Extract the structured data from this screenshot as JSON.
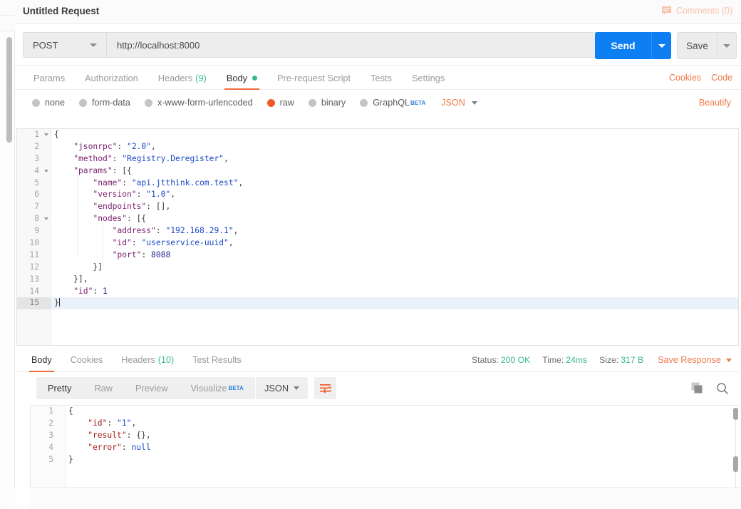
{
  "request": {
    "title": "Untitled Request",
    "comments_label": "Comments (0)",
    "method": "POST",
    "url": "http://localhost:8000",
    "send_label": "Send",
    "save_label": "Save",
    "tabs": [
      {
        "label": "Params",
        "active": false
      },
      {
        "label": "Authorization",
        "active": false
      },
      {
        "label": "Headers",
        "count": "(9)",
        "active": false
      },
      {
        "label": "Body",
        "active": true,
        "dot": true
      },
      {
        "label": "Pre-request Script",
        "active": false
      },
      {
        "label": "Tests",
        "active": false
      },
      {
        "label": "Settings",
        "active": false
      }
    ],
    "header_links": [
      "Cookies",
      "Code"
    ],
    "body_types": [
      {
        "label": "none",
        "selected": false
      },
      {
        "label": "form-data",
        "selected": false
      },
      {
        "label": "x-www-form-urlencoded",
        "selected": false
      },
      {
        "label": "raw",
        "selected": true
      },
      {
        "label": "binary",
        "selected": false
      },
      {
        "label": "GraphQL",
        "selected": false,
        "beta": "BETA"
      }
    ],
    "format_label": "JSON",
    "beautify_label": "Beautify",
    "editor_lines": [
      {
        "n": "1",
        "fold": true,
        "active": false,
        "tokens": [
          {
            "t": "{",
            "c": "jpun"
          }
        ]
      },
      {
        "n": "2",
        "fold": false,
        "active": false,
        "tokens": [
          {
            "t": "    \"jsonrpc\"",
            "c": "jkey"
          },
          {
            "t": ": ",
            "c": "jpun"
          },
          {
            "t": "\"2.0\"",
            "c": "jstr"
          },
          {
            "t": ",",
            "c": "jpun"
          }
        ]
      },
      {
        "n": "3",
        "fold": false,
        "active": false,
        "tokens": [
          {
            "t": "    \"method\"",
            "c": "jkey"
          },
          {
            "t": ": ",
            "c": "jpun"
          },
          {
            "t": "\"Registry.Deregister\"",
            "c": "jstr"
          },
          {
            "t": ",",
            "c": "jpun"
          }
        ]
      },
      {
        "n": "4",
        "fold": true,
        "active": false,
        "tokens": [
          {
            "t": "    \"params\"",
            "c": "jkey"
          },
          {
            "t": ": [{",
            "c": "jpun"
          }
        ]
      },
      {
        "n": "5",
        "fold": false,
        "active": false,
        "tokens": [
          {
            "t": "        \"name\"",
            "c": "jkey"
          },
          {
            "t": ": ",
            "c": "jpun"
          },
          {
            "t": "\"api.jtthink.com.test\"",
            "c": "jstr"
          },
          {
            "t": ",",
            "c": "jpun"
          }
        ]
      },
      {
        "n": "6",
        "fold": false,
        "active": false,
        "tokens": [
          {
            "t": "        \"version\"",
            "c": "jkey"
          },
          {
            "t": ": ",
            "c": "jpun"
          },
          {
            "t": "\"1.0\"",
            "c": "jstr"
          },
          {
            "t": ",",
            "c": "jpun"
          }
        ]
      },
      {
        "n": "7",
        "fold": false,
        "active": false,
        "tokens": [
          {
            "t": "        \"endpoints\"",
            "c": "jkey"
          },
          {
            "t": ": [],",
            "c": "jpun"
          }
        ]
      },
      {
        "n": "8",
        "fold": true,
        "active": false,
        "tokens": [
          {
            "t": "        \"nodes\"",
            "c": "jkey"
          },
          {
            "t": ": [{",
            "c": "jpun"
          }
        ]
      },
      {
        "n": "9",
        "fold": false,
        "active": false,
        "tokens": [
          {
            "t": "            \"address\"",
            "c": "jkey"
          },
          {
            "t": ": ",
            "c": "jpun"
          },
          {
            "t": "\"192.168.29.1\"",
            "c": "jstr"
          },
          {
            "t": ",",
            "c": "jpun"
          }
        ]
      },
      {
        "n": "10",
        "fold": false,
        "active": false,
        "tokens": [
          {
            "t": "            \"id\"",
            "c": "jkey"
          },
          {
            "t": ": ",
            "c": "jpun"
          },
          {
            "t": "\"userservice-uuid\"",
            "c": "jstr"
          },
          {
            "t": ",",
            "c": "jpun"
          }
        ]
      },
      {
        "n": "11",
        "fold": false,
        "active": false,
        "tokens": [
          {
            "t": "            \"port\"",
            "c": "jkey"
          },
          {
            "t": ": ",
            "c": "jpun"
          },
          {
            "t": "8088",
            "c": "jnum"
          }
        ]
      },
      {
        "n": "12",
        "fold": false,
        "active": false,
        "tokens": [
          {
            "t": "        }]",
            "c": "jpun"
          }
        ]
      },
      {
        "n": "13",
        "fold": false,
        "active": false,
        "tokens": [
          {
            "t": "    }],",
            "c": "jpun"
          }
        ]
      },
      {
        "n": "14",
        "fold": false,
        "active": false,
        "tokens": [
          {
            "t": "    \"id\"",
            "c": "jkey"
          },
          {
            "t": ": ",
            "c": "jpun"
          },
          {
            "t": "1",
            "c": "jnum"
          }
        ]
      },
      {
        "n": "15",
        "fold": false,
        "active": true,
        "tokens": [
          {
            "t": "}",
            "c": "jpun"
          }
        ]
      }
    ]
  },
  "response": {
    "tabs": [
      {
        "label": "Body",
        "active": true
      },
      {
        "label": "Cookies",
        "active": false
      },
      {
        "label": "Headers",
        "count": "(10)",
        "active": false
      },
      {
        "label": "Test Results",
        "active": false
      }
    ],
    "status_label": "Status:",
    "status_value": "200 OK",
    "time_label": "Time:",
    "time_value": "24ms",
    "size_label": "Size:",
    "size_value": "317 B",
    "save_response_label": "Save Response",
    "view_modes": [
      {
        "label": "Pretty",
        "active": true
      },
      {
        "label": "Raw",
        "active": false
      },
      {
        "label": "Preview",
        "active": false
      },
      {
        "label": "Visualize",
        "active": false,
        "beta": "BETA"
      }
    ],
    "format_label": "JSON",
    "body_lines": [
      {
        "n": "1",
        "tokens": [
          {
            "t": "{",
            "c": "jpun"
          }
        ]
      },
      {
        "n": "2",
        "tokens": [
          {
            "t": "    \"id\"",
            "c": "rkey"
          },
          {
            "t": ": ",
            "c": "jpun"
          },
          {
            "t": "\"1\"",
            "c": "rstr"
          },
          {
            "t": ",",
            "c": "jpun"
          }
        ]
      },
      {
        "n": "3",
        "tokens": [
          {
            "t": "    \"result\"",
            "c": "rkey"
          },
          {
            "t": ": {},",
            "c": "jpun"
          }
        ]
      },
      {
        "n": "4",
        "tokens": [
          {
            "t": "    \"error\"",
            "c": "rkey"
          },
          {
            "t": ": ",
            "c": "jpun"
          },
          {
            "t": "null",
            "c": "rnull"
          }
        ]
      },
      {
        "n": "5",
        "tokens": [
          {
            "t": "}",
            "c": "jpun"
          }
        ]
      }
    ]
  },
  "colors": {
    "accent_orange": "#f26b3a",
    "send_blue": "#0d7ff3",
    "status_green": "#3ab88a",
    "comments_peach": "#f8c4ae"
  }
}
